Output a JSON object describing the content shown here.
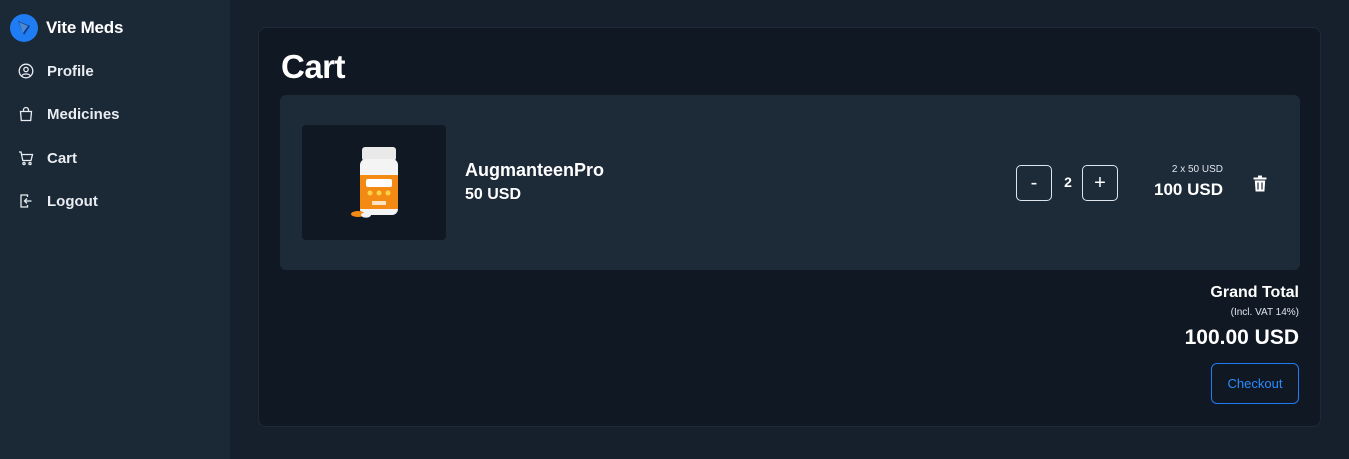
{
  "app": {
    "name": "Vite Meds",
    "accent": "#1f7cf3"
  },
  "sidebar": {
    "items": [
      {
        "label": "Profile",
        "icon": "user-circle-icon"
      },
      {
        "label": "Medicines",
        "icon": "shopping-bag-icon"
      },
      {
        "label": "Cart",
        "icon": "cart-icon"
      },
      {
        "label": "Logout",
        "icon": "logout-icon"
      }
    ]
  },
  "cart": {
    "title": "Cart",
    "items": [
      {
        "name": "AugmanteenPro",
        "price": "50 USD",
        "image": "medicine-bottle-image",
        "quantity": "2",
        "decrement_label": "-",
        "increment_label": "+",
        "unit_breakdown": "2 x 50 USD",
        "line_total": "100 USD"
      }
    ],
    "grand_total_label": "Grand Total",
    "vat_note": "(Incl. VAT 14%)",
    "grand_total": "100.00 USD",
    "checkout_label": "Checkout"
  }
}
